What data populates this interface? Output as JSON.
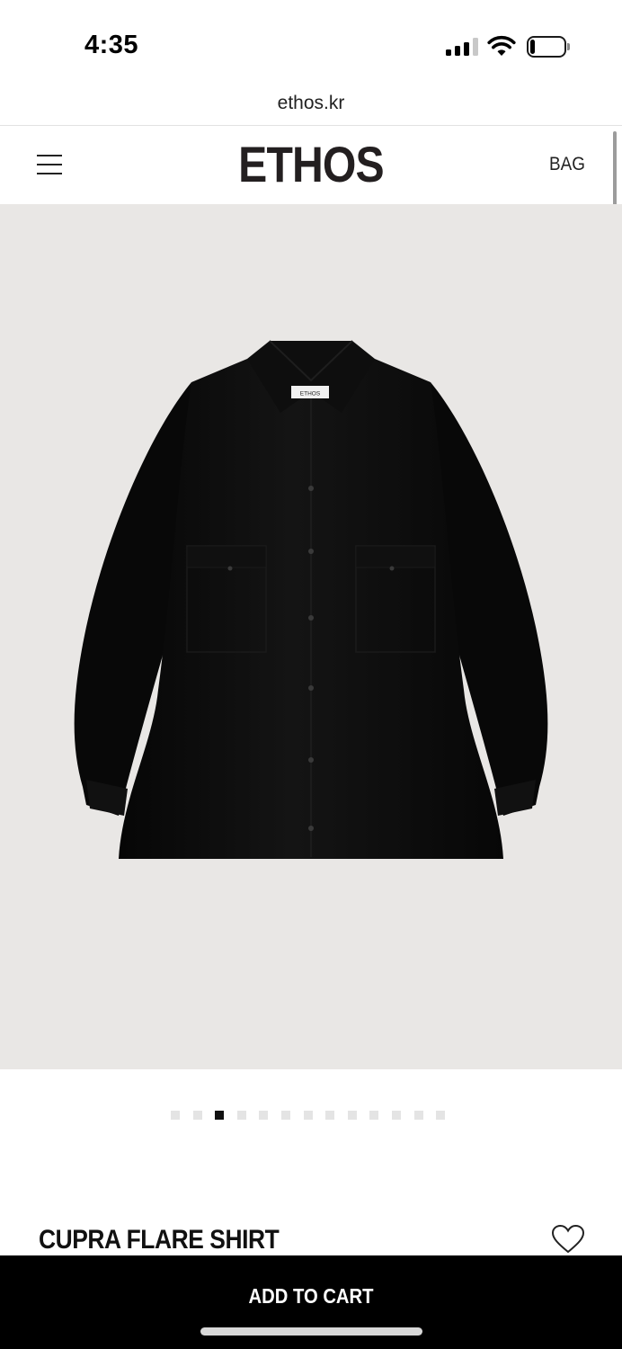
{
  "status_bar": {
    "time": "4:35",
    "signal_icon": "cellular-signal-icon",
    "wifi_icon": "wifi-icon",
    "battery_icon": "battery-icon",
    "battery_level": 0.15
  },
  "browser": {
    "url": "ethos.kr"
  },
  "header": {
    "menu_icon": "hamburger-menu-icon",
    "logo": "ETHOS",
    "bag_label": "BAG"
  },
  "product_image": {
    "label_tag": "ETHOS",
    "background": "#e9e7e5",
    "garment_color": "#0b0b0b"
  },
  "gallery": {
    "total": 13,
    "current": 3
  },
  "product": {
    "name": "CUPRA FLARE SHIRT",
    "wishlist_icon": "heart-icon"
  },
  "cart": {
    "label": "ADD TO CART",
    "background": "#000000"
  }
}
